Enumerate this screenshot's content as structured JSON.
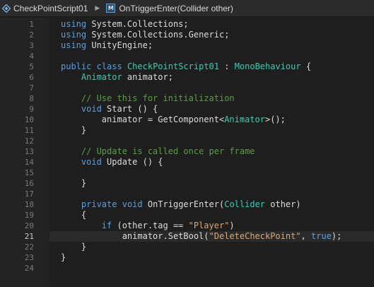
{
  "breadcrumb": {
    "file": "CheckPointScript01",
    "method_icon_letter": "M",
    "method": "OnTriggerEnter(Collider other)"
  },
  "editor": {
    "current_line": 21,
    "lines": [
      {
        "n": "1",
        "tokens": [
          {
            "t": "using",
            "k": "keyword"
          },
          {
            "t": " System.Collections;",
            "k": "text"
          }
        ]
      },
      {
        "n": "2",
        "tokens": [
          {
            "t": "using",
            "k": "keyword"
          },
          {
            "t": " System.Collections.Generic;",
            "k": "text"
          }
        ]
      },
      {
        "n": "3",
        "tokens": [
          {
            "t": "using",
            "k": "keyword"
          },
          {
            "t": " UnityEngine;",
            "k": "text"
          }
        ]
      },
      {
        "n": "4",
        "tokens": []
      },
      {
        "n": "5",
        "tokens": [
          {
            "t": "public",
            "k": "keyword"
          },
          {
            "t": " ",
            "k": "text"
          },
          {
            "t": "class",
            "k": "keyword"
          },
          {
            "t": " ",
            "k": "text"
          },
          {
            "t": "CheckPointScript01",
            "k": "type"
          },
          {
            "t": " : ",
            "k": "text"
          },
          {
            "t": "MonoBehaviour",
            "k": "type"
          },
          {
            "t": " {",
            "k": "text"
          }
        ]
      },
      {
        "n": "6",
        "tokens": [
          {
            "t": "    ",
            "k": "text"
          },
          {
            "t": "Animator",
            "k": "type"
          },
          {
            "t": " animator;",
            "k": "text"
          }
        ]
      },
      {
        "n": "7",
        "tokens": []
      },
      {
        "n": "8",
        "tokens": [
          {
            "t": "    // Use this for initialization",
            "k": "comment"
          }
        ]
      },
      {
        "n": "9",
        "tokens": [
          {
            "t": "    ",
            "k": "text"
          },
          {
            "t": "void",
            "k": "keyword"
          },
          {
            "t": " Start () {",
            "k": "text"
          }
        ]
      },
      {
        "n": "10",
        "tokens": [
          {
            "t": "        animator = GetComponent<",
            "k": "text"
          },
          {
            "t": "Animator",
            "k": "type"
          },
          {
            "t": ">();",
            "k": "text"
          }
        ]
      },
      {
        "n": "11",
        "tokens": [
          {
            "t": "    }",
            "k": "text"
          }
        ]
      },
      {
        "n": "12",
        "tokens": []
      },
      {
        "n": "13",
        "tokens": [
          {
            "t": "    // Update is called once per frame",
            "k": "comment"
          }
        ]
      },
      {
        "n": "14",
        "tokens": [
          {
            "t": "    ",
            "k": "text"
          },
          {
            "t": "void",
            "k": "keyword"
          },
          {
            "t": " Update () {",
            "k": "text"
          }
        ]
      },
      {
        "n": "15",
        "tokens": []
      },
      {
        "n": "16",
        "tokens": [
          {
            "t": "    }",
            "k": "text"
          }
        ]
      },
      {
        "n": "17",
        "tokens": []
      },
      {
        "n": "18",
        "tokens": [
          {
            "t": "    ",
            "k": "text"
          },
          {
            "t": "private",
            "k": "keyword"
          },
          {
            "t": " ",
            "k": "text"
          },
          {
            "t": "void",
            "k": "keyword"
          },
          {
            "t": " OnTriggerEnter(",
            "k": "text"
          },
          {
            "t": "Collider",
            "k": "type"
          },
          {
            "t": " other)",
            "k": "text"
          }
        ]
      },
      {
        "n": "19",
        "tokens": [
          {
            "t": "    {",
            "k": "text"
          }
        ]
      },
      {
        "n": "20",
        "tokens": [
          {
            "t": "        ",
            "k": "text"
          },
          {
            "t": "if",
            "k": "keyword"
          },
          {
            "t": " (other.tag == ",
            "k": "text"
          },
          {
            "t": "\"Player\"",
            "k": "string"
          },
          {
            "t": ")",
            "k": "text"
          }
        ]
      },
      {
        "n": "21",
        "tokens": [
          {
            "t": "            animator.SetBool(",
            "k": "text"
          },
          {
            "t": "\"DeleteCheckPoint\"",
            "k": "string"
          },
          {
            "t": ", ",
            "k": "text"
          },
          {
            "t": "true",
            "k": "keyword"
          },
          {
            "t": ");",
            "k": "text"
          }
        ]
      },
      {
        "n": "22",
        "tokens": [
          {
            "t": "    }",
            "k": "text"
          }
        ]
      },
      {
        "n": "23",
        "tokens": [
          {
            "t": "}",
            "k": "text"
          }
        ]
      },
      {
        "n": "24",
        "tokens": []
      }
    ]
  }
}
